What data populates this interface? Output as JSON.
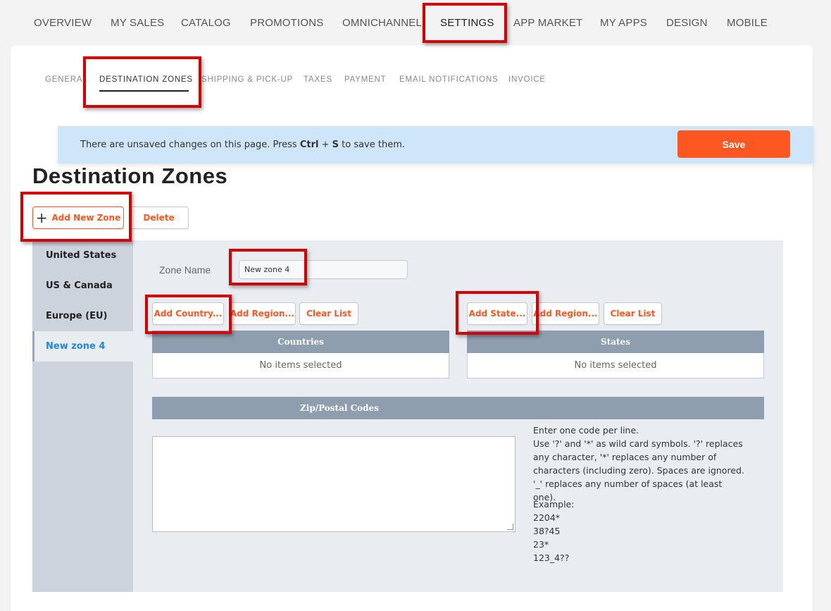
{
  "topnav": {
    "tabs": [
      {
        "label": "OVERVIEW"
      },
      {
        "label": "MY SALES"
      },
      {
        "label": "CATALOG"
      },
      {
        "label": "PROMOTIONS"
      },
      {
        "label": "OMNICHANNEL"
      },
      {
        "label": "SETTINGS"
      },
      {
        "label": "APP MARKET"
      },
      {
        "label": "MY APPS"
      },
      {
        "label": "DESIGN"
      },
      {
        "label": "MOBILE"
      }
    ]
  },
  "subnav": {
    "tabs": [
      {
        "label": "GENERAL"
      },
      {
        "label": "DESTINATION ZONES"
      },
      {
        "label": "SHIPPING & PICK-UP"
      },
      {
        "label": "TAXES"
      },
      {
        "label": "PAYMENT"
      },
      {
        "label": "EMAIL NOTIFICATIONS"
      },
      {
        "label": "INVOICE"
      }
    ]
  },
  "banner": {
    "msg_pre": "There are unsaved changes on this page. Press ",
    "key1": "Ctrl",
    "plus": " + ",
    "key2": "S",
    "msg_post": " to save them.",
    "save_label": "Save"
  },
  "page": {
    "title": "Destination Zones",
    "add_zone_label": "Add New Zone",
    "delete_label": "Delete"
  },
  "zones": [
    {
      "name": "United States"
    },
    {
      "name": "US & Canada"
    },
    {
      "name": "Europe (EU)"
    },
    {
      "name": "New zone 4"
    }
  ],
  "editor": {
    "zone_name_label": "Zone Name",
    "zone_name_value": "New zone 4",
    "countries": {
      "add_country": "Add Country...",
      "add_region": "Add Region...",
      "clear": "Clear List",
      "header": "Countries",
      "empty": "No items selected"
    },
    "states": {
      "add_state": "Add State...",
      "add_region": "Add Region...",
      "clear": "Clear List",
      "header": "States",
      "empty": "No items selected"
    },
    "zip": {
      "header": "Zip/Postal Codes",
      "help1": "Enter one code per line.",
      "help2": "Use '?' and '*' as wild card symbols. '?' replaces any character, '*' replaces any number of characters (including zero). Spaces are ignored. '_' replaces any number of spaces (at least one).",
      "example_label": "Example:",
      "examples": [
        "2204*",
        "38?45",
        "23*",
        "123_4??"
      ]
    }
  },
  "colors": {
    "accent": "#ff5722",
    "highlight": "#d50000",
    "banner": "#cfe6f9",
    "table_header": "#8f9eae",
    "selected_zone_text": "#1e88e5"
  }
}
